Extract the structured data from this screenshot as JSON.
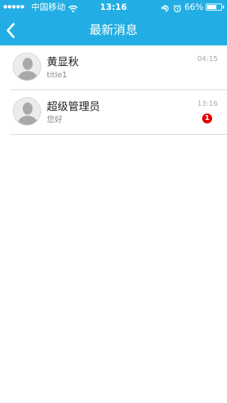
{
  "status_bar": {
    "carrier": "中国移动",
    "time": "13:16",
    "battery_percent": "66%",
    "battery_level": 0.66
  },
  "nav": {
    "title": "最新消息",
    "back_icon": "chevron-left-icon"
  },
  "conversations": [
    {
      "name": "黄显秋",
      "preview": "title1",
      "time": "04:15",
      "unread": ""
    },
    {
      "name": "超级管理员",
      "preview": "您好",
      "time": "13:16",
      "unread": "1"
    }
  ],
  "colors": {
    "header": "#22aee4",
    "badge": "#e50000"
  }
}
